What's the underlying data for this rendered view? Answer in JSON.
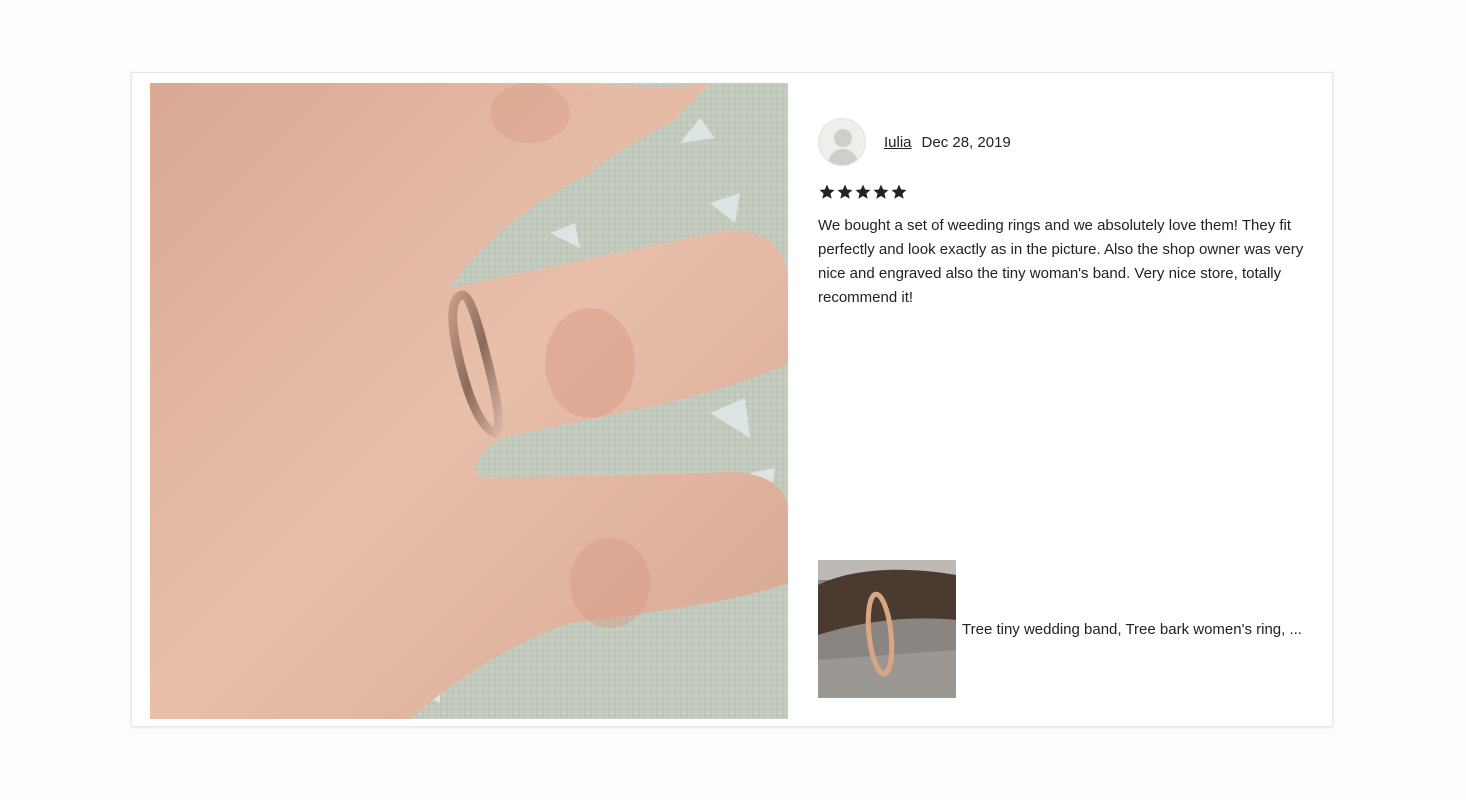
{
  "review": {
    "reviewer_name": "Iulia",
    "date": "Dec 28, 2019",
    "rating": 5,
    "text": "We bought a set of weeding rings and we absolutely love them! They fit perfectly and look exactly as in the picture. Also the shop owner was very nice and engraved also the tiny woman's band. Very nice store, totally recommend it!"
  },
  "listing": {
    "title": "Tree tiny wedding band, Tree bark women's ring, ..."
  },
  "icons": {
    "avatar": "default-user-silhouette-icon",
    "star": "star-icon"
  },
  "colors": {
    "star": "#222222",
    "text": "#222222"
  }
}
